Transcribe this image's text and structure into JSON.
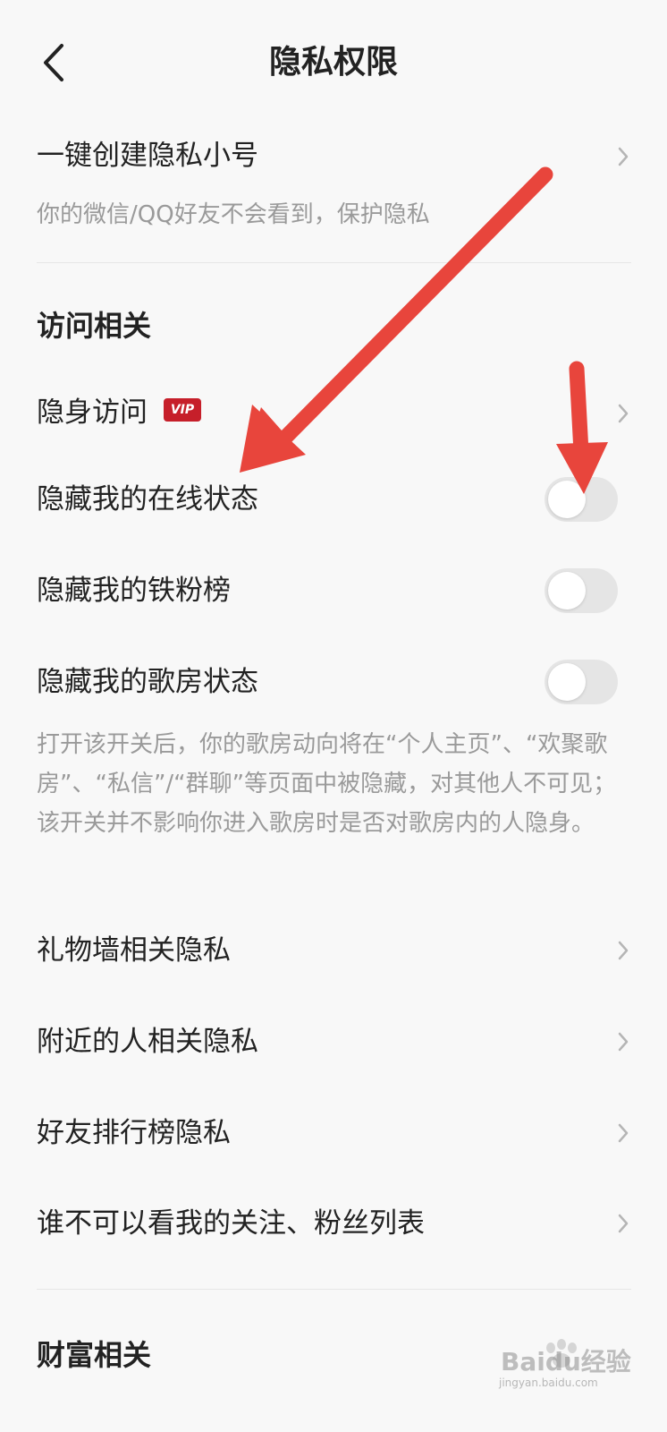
{
  "header": {
    "title": "隐私权限",
    "back_icon": "chevron-left-icon"
  },
  "quick": {
    "label": "一键创建隐私小号",
    "desc": "你的微信/QQ好友不会看到，保护隐私"
  },
  "visit_section": {
    "title": "访问相关",
    "invisible_visit": {
      "label": "隐身访问",
      "badge": "VIP"
    },
    "toggles": [
      {
        "label": "隐藏我的在线状态",
        "on": false
      },
      {
        "label": "隐藏我的铁粉榜",
        "on": false
      },
      {
        "label": "隐藏我的歌房状态",
        "on": false
      }
    ],
    "ktv_desc": "打开该开关后，你的歌房动向将在“个人主页”、“欢聚歌房”、“私信”/“群聊”等页面中被隐藏，对其他人不可见；该开关并不影响你进入歌房时是否对歌房内的人隐身。"
  },
  "menu_items": [
    {
      "label": "礼物墙相关隐私"
    },
    {
      "label": "附近的人相关隐私"
    },
    {
      "label": "好友排行榜隐私"
    },
    {
      "label": "谁不可以看我的关注、粉丝列表"
    }
  ],
  "wealth_section": {
    "title": "财富相关"
  },
  "watermark": {
    "text": "Baidu经验",
    "sub": "jingyan.baidu.com"
  },
  "colors": {
    "annotation_arrow": "#e8453c",
    "vip_badge": "#c61f2a",
    "toggle_off": "#e5e5e5"
  }
}
